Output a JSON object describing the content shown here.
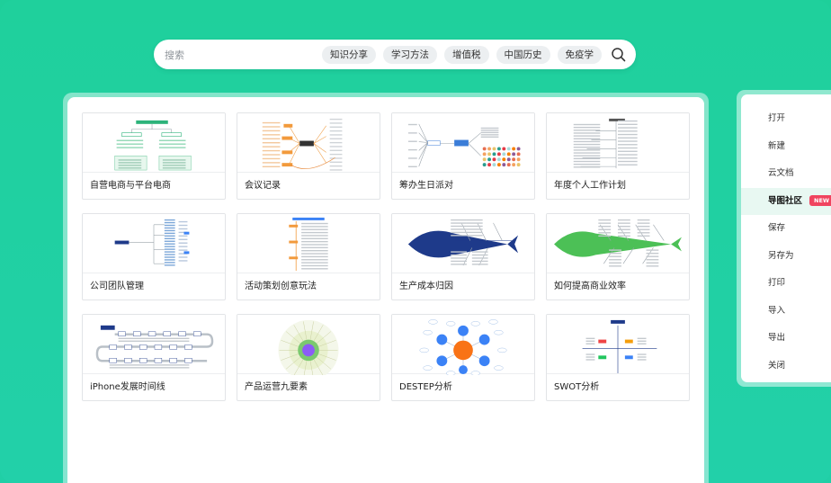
{
  "search": {
    "placeholder": "搜索",
    "chips": [
      "知识分享",
      "学习方法",
      "增值税",
      "中国历史",
      "免疫学"
    ]
  },
  "templates": [
    {
      "title": "自营电商与平台电商",
      "kind": "tree"
    },
    {
      "title": "会议记录",
      "kind": "orange"
    },
    {
      "title": "筹办生日派对",
      "kind": "party"
    },
    {
      "title": "年度个人工作计划",
      "kind": "plan"
    },
    {
      "title": "公司团队管理",
      "kind": "team"
    },
    {
      "title": "活动策划创意玩法",
      "kind": "timeline-v"
    },
    {
      "title": "生产成本归因",
      "kind": "fish-blue"
    },
    {
      "title": "如何提高商业效率",
      "kind": "fish-green"
    },
    {
      "title": "iPhone发展时间线",
      "kind": "snake"
    },
    {
      "title": "产品运营九要素",
      "kind": "radial"
    },
    {
      "title": "DESTEP分析",
      "kind": "bubbles"
    },
    {
      "title": "SWOT分析",
      "kind": "swot"
    }
  ],
  "menu": {
    "items": [
      "打开",
      "新建",
      "云文档",
      "导图社区",
      "保存",
      "另存为",
      "打印",
      "导入",
      "导出",
      "关闭"
    ],
    "active_index": 3,
    "badge": "NEW"
  },
  "colors": {
    "background": "#1fd09c",
    "accent": "#1fc08f",
    "badge": "#f0445f"
  }
}
